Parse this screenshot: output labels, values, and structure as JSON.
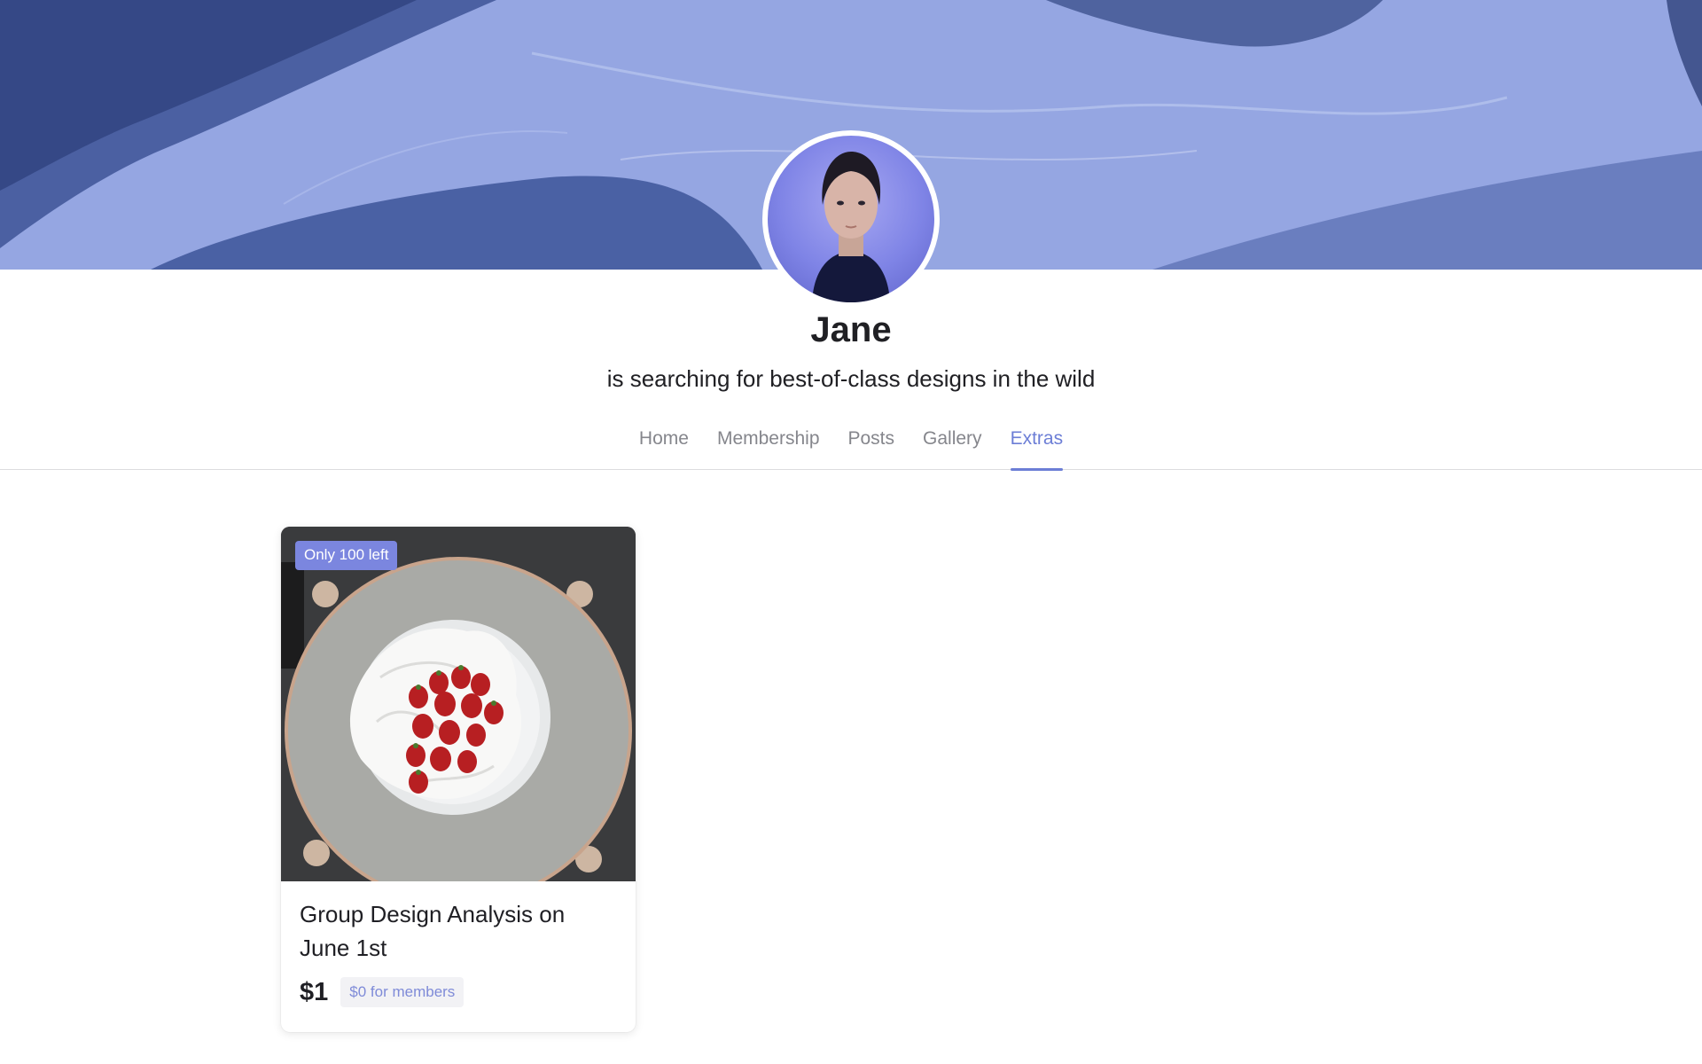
{
  "profile": {
    "name": "Jane",
    "tagline": "is searching for best-of-class designs in the wild"
  },
  "tabs": [
    {
      "label": "Home",
      "active": false
    },
    {
      "label": "Membership",
      "active": false
    },
    {
      "label": "Posts",
      "active": false
    },
    {
      "label": "Gallery",
      "active": false
    },
    {
      "label": "Extras",
      "active": true
    }
  ],
  "product": {
    "badge": "Only 100 left",
    "title": "Group Design Analysis on June 1st",
    "price": "$1",
    "member_price": "$0 for members"
  },
  "colors": {
    "accent": "#6c7ed6",
    "badge": "#7b86df",
    "tab_inactive": "#85868c"
  }
}
